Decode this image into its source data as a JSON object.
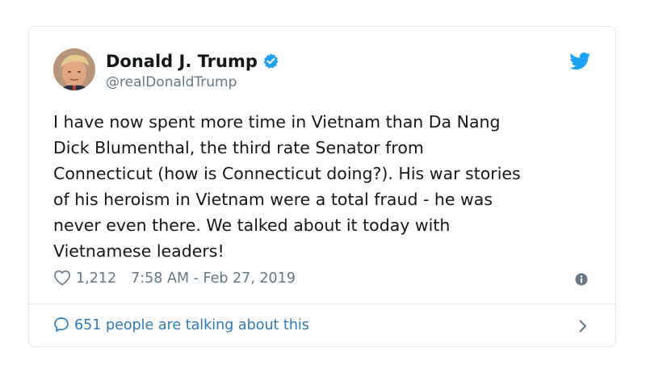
{
  "author": {
    "name": "Donald J. Trump",
    "handle": "@realDonaldTrump",
    "verified": true
  },
  "tweet": {
    "text": "I have now spent more time in Vietnam than Da Nang\nDick Blumenthal, the third rate Senator from\nConnecticut (how is Connecticut doing?). His war stories\nof his heroism in Vietnam were a total fraud - he was\nnever even there. We talked about it today with\nVietnamese leaders!",
    "like_count": "1,212",
    "timestamp": "7:58 AM - Feb 27, 2019"
  },
  "conversation": {
    "label": "651 people are talking about this"
  },
  "colors": {
    "accent": "#1da1f2",
    "link": "#2b7bb9",
    "muted": "#657786",
    "border": "#e1e8ed"
  },
  "icons": {
    "brand": "twitter-bird-icon",
    "verified": "verified-badge-icon",
    "like": "heart-icon",
    "info": "info-icon",
    "reply": "speech-bubble-icon",
    "more": "chevron-right-icon"
  }
}
